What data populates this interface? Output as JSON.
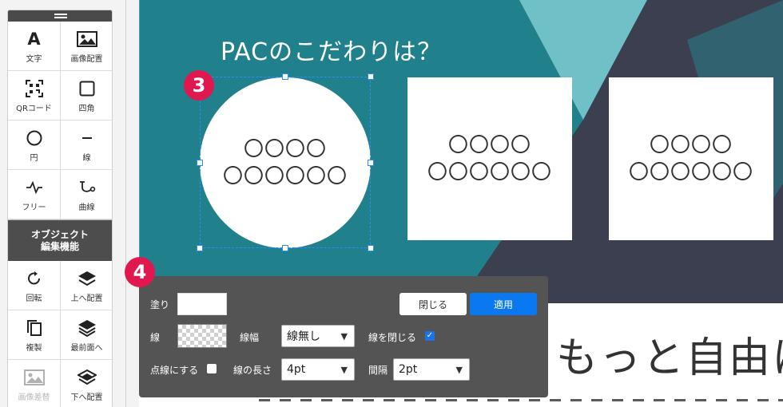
{
  "toolbar": {
    "tools": [
      {
        "icon": "A",
        "icon_name": "text-icon",
        "label": "文字"
      },
      {
        "icon": "",
        "icon_name": "image-icon",
        "label": "画像配置"
      },
      {
        "icon": "",
        "icon_name": "qr-code-icon",
        "label": "QRコード"
      },
      {
        "icon": "",
        "icon_name": "square-icon",
        "label": "四角"
      },
      {
        "icon": "",
        "icon_name": "circle-icon",
        "label": "円"
      },
      {
        "icon": "",
        "icon_name": "line-icon",
        "label": "線"
      },
      {
        "icon": "",
        "icon_name": "freehand-icon",
        "label": "フリー"
      },
      {
        "icon": "",
        "icon_name": "curve-icon",
        "label": "曲線"
      }
    ],
    "object_header_line1": "オブジェクト",
    "object_header_line2": "編集機能",
    "object_tools": [
      {
        "icon_name": "rotate-icon",
        "label": "回転"
      },
      {
        "icon_name": "layer-up-icon",
        "label": "上へ配置"
      },
      {
        "icon_name": "duplicate-icon",
        "label": "複製"
      },
      {
        "icon_name": "bring-to-front-icon",
        "label": "最前面へ"
      },
      {
        "icon_name": "image-swap-icon",
        "label": "画像差替",
        "disabled": true
      },
      {
        "icon_name": "layer-down-icon",
        "label": "下へ配置"
      }
    ]
  },
  "canvas": {
    "headline": "PACのこだわりは？",
    "cards": [
      {
        "line1": "〇〇〇〇",
        "line2": "〇〇〇〇〇〇"
      },
      {
        "line1": "〇〇〇〇",
        "line2": "〇〇〇〇〇〇"
      },
      {
        "line1": "〇〇〇〇",
        "line2": "〇〇〇〇〇〇"
      }
    ],
    "big_text": "もっと自由に",
    "colors": {
      "teal": "#20808b",
      "dark": "#3b3f4f",
      "light_teal": "#6fc0c7"
    }
  },
  "badges": {
    "step3": "3",
    "step4": "4",
    "color": "#e0184f"
  },
  "panel": {
    "fill_label": "塗り",
    "fill_color": "#ffffff",
    "stroke_label": "線",
    "stroke_width_label": "線幅",
    "stroke_width_value": "線無し",
    "close_path_label": "線を閉じる",
    "close_path_checked": true,
    "dashed_label": "点線にする",
    "dashed_checked": false,
    "dash_length_label": "線の長さ",
    "dash_length_value": "4pt",
    "gap_label": "間隔",
    "gap_value": "2pt",
    "close_button": "閉じる",
    "apply_button": "適用",
    "accent_color": "#0a78f0"
  }
}
